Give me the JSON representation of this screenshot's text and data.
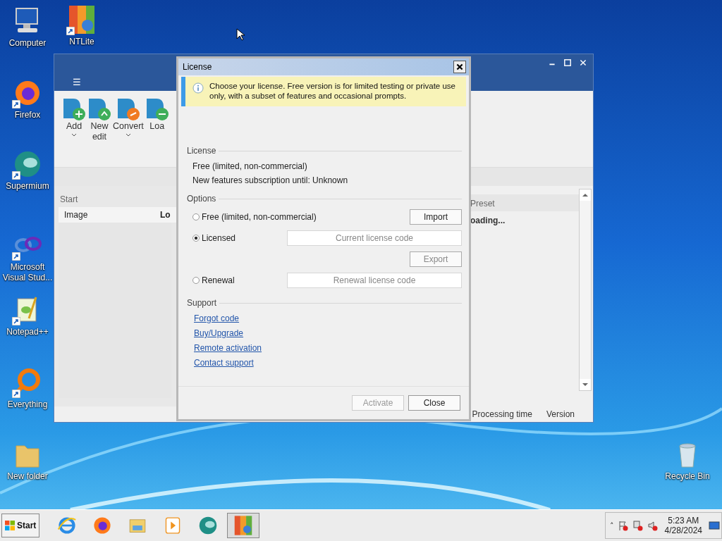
{
  "desktop_icons": [
    {
      "label": "Computer",
      "kind": "computer",
      "shortcut": false
    },
    {
      "label": "NTLite",
      "kind": "ntlite",
      "shortcut": true
    },
    {
      "label": "Firefox",
      "kind": "firefox",
      "shortcut": true
    },
    {
      "label": "Supermium",
      "kind": "supermium",
      "shortcut": true
    },
    {
      "label": "Microsoft Visual Stud...",
      "kind": "vstudio",
      "shortcut": true
    },
    {
      "label": "Notepad++",
      "kind": "notepad",
      "shortcut": true
    },
    {
      "label": "Everything",
      "kind": "everything",
      "shortcut": true
    },
    {
      "label": "New folder",
      "kind": "folder",
      "shortcut": false
    },
    {
      "label": "Recycle Bin",
      "kind": "recycle",
      "shortcut": false
    }
  ],
  "app_window": {
    "menu_glyph": "☰",
    "ribbon": [
      {
        "label": "Add",
        "kind": "add",
        "dropdown": true
      },
      {
        "label": "New edit",
        "kind": "new",
        "dropdown": false
      },
      {
        "label": "Convert",
        "kind": "convert",
        "dropdown": true
      },
      {
        "label": "Loa",
        "kind": "load",
        "dropdown": false
      }
    ],
    "section_label": "Start",
    "columns_left": [
      "Image",
      "Lo"
    ],
    "column_right": "Preset",
    "loading_text": "oading...",
    "status_bar": [
      "Processing time",
      "Version"
    ]
  },
  "dialog": {
    "title": "License",
    "info": "Choose your license. Free version is for limited testing or private use only, with a subset of features and occasional prompts.",
    "license_heading": "License",
    "license_lines": [
      "Free (limited, non-commercial)",
      "New features subscription until: Unknown"
    ],
    "options_heading": "Options",
    "option_rows": [
      {
        "radio": {
          "label": "Free (limited, non-commercial)",
          "selected": false
        },
        "button": {
          "label": "Import",
          "kind": "small",
          "disabled": false
        }
      },
      {
        "radio": {
          "label": "Licensed",
          "selected": true
        },
        "button": {
          "label": "Current license code",
          "kind": "wide",
          "disabled": true
        }
      },
      {
        "button": {
          "label": "Export",
          "kind": "small",
          "disabled": true
        }
      },
      {
        "radio": {
          "label": "Renewal",
          "selected": false
        },
        "button": {
          "label": "Renewal license code",
          "kind": "wide",
          "disabled": true
        }
      }
    ],
    "support_heading": "Support",
    "links": [
      "Forgot code",
      "Buy/Upgrade",
      "Remote activation",
      "Contact support"
    ],
    "buttons": [
      {
        "label": "Activate",
        "disabled": true
      },
      {
        "label": "Close",
        "disabled": false
      }
    ]
  },
  "taskbar": {
    "start": "Start",
    "apps": [
      {
        "kind": "ie",
        "selected": false
      },
      {
        "kind": "firefox",
        "selected": false
      },
      {
        "kind": "explorer",
        "selected": false
      },
      {
        "kind": "media",
        "selected": false
      },
      {
        "kind": "supermium",
        "selected": false
      },
      {
        "kind": "ntlite",
        "selected": true
      }
    ],
    "tray_glyph": "˄",
    "time": "5:23 AM",
    "date": "4/28/2024"
  }
}
